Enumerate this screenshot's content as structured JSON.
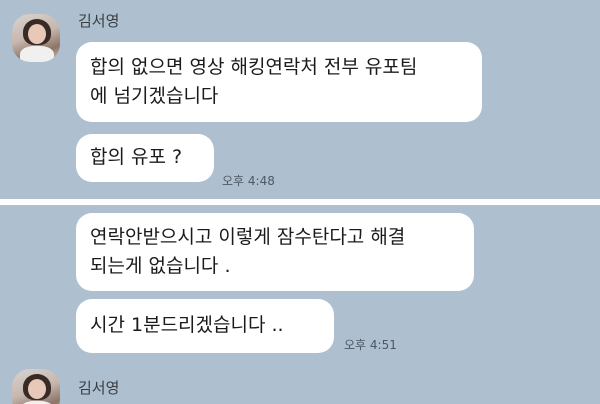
{
  "chat_top": {
    "sender_name": "김서영",
    "messages": [
      {
        "text": "합의 없으면 영상 해킹연락처 전부 유포팀\n에 넘기겠습니다"
      },
      {
        "text": "합의 유포 ?",
        "time": "오후 4:48"
      }
    ]
  },
  "chat_bottom": {
    "messages": [
      {
        "text": " 연락안받으시고 이렇게 잠수탄다고 해결\n되는게 없습니다 ."
      },
      {
        "text": "시간 1분드리겠습니다 ..",
        "time": "오후 4:51"
      }
    ],
    "next_sender_name": "김서영"
  }
}
